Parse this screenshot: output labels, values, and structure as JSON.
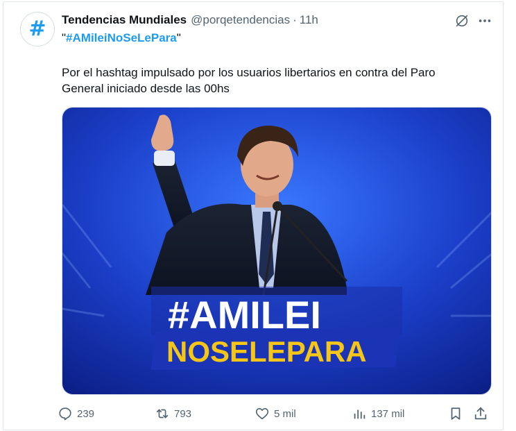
{
  "tweet": {
    "author_name": "Tendencias Mundiales",
    "handle": "@porqetendencias",
    "separator": "·",
    "time": "11h",
    "hashtag_quote_open": "\"",
    "hashtag": "#AMileiNoSeLePara",
    "hashtag_quote_close": "\"",
    "text": "Por el hashtag impulsado por los usuarios libertarios en contra del Paro General iniciado desde las 00hs",
    "avatar_glyph": "#"
  },
  "media": {
    "overlay_line1": "#AMILEI",
    "overlay_line2": "NOSELEPARA"
  },
  "actions": {
    "replies": "239",
    "retweets": "793",
    "likes": "5 mil",
    "views": "137 mil"
  },
  "icons": {
    "avatar": "hashtag-icon",
    "grok": "grok-icon",
    "more": "more-icon",
    "reply": "reply-icon",
    "retweet": "retweet-icon",
    "like": "heart-icon",
    "views": "views-icon",
    "bookmark": "bookmark-icon",
    "share": "share-icon"
  },
  "colors": {
    "accent": "#1d9bf0",
    "muted": "#536471",
    "overlay_yellow": "#f5c518"
  }
}
